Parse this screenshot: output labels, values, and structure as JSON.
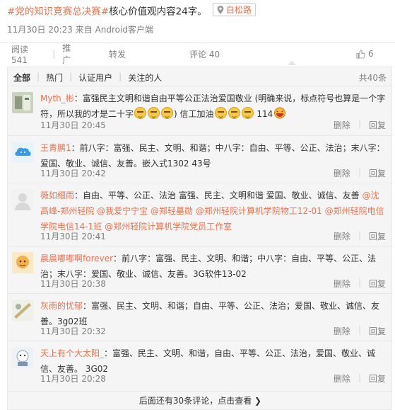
{
  "post": {
    "hashtag": "#党的知识竞赛总决赛#",
    "text": "核心价值观内容24字。",
    "location": "白松路",
    "meta": "11月30日 20:23 来自 Android客户端"
  },
  "actions": {
    "reads": "阅读 541",
    "promote": "推广",
    "repost": "转发",
    "comment": "评论 40",
    "likes": "6"
  },
  "filters": [
    "全部",
    "热门",
    "认证用户",
    "关注的人"
  ],
  "total": "共40条",
  "ops": {
    "delete": "删除",
    "reply": "回复"
  },
  "comments": [
    {
      "user": "Myth_彬",
      "colon": "：",
      "text_a": "富强民主文明和谐自由平等公正法治爱国敬业 (明确来说，标点符号也算是一个字符，所以我的才是二十字",
      "text_b": ") 信工加油",
      "text_c": " 114",
      "time": "11月30日 20:45"
    },
    {
      "user": "王青鹏1",
      "colon": "：",
      "text": "前八字：富强、民主、文明、和谐；中八字：自由、平等、公正、法治；末八字：爱国、敬业、诚信、友善。嵌入式1302 43号",
      "time": "11月30日 20:42"
    },
    {
      "user": "薇如细雨",
      "colon": "：",
      "text": "自由、平等、公正、法治 富强、民主、文明和谐 爱国、敬业、诚信、友善",
      "mentions": [
        "@沈高峰-郑州轻院",
        "@我爱宁宁宝",
        "@郑轻墓勋",
        "@郑州轻院计算机学院物工12-01",
        "@郑州轻院电信学院电信14-1班",
        "@郑州轻院计算机学院党员工作室"
      ],
      "time": "11月30日 20:41"
    },
    {
      "user": "晨晨嘟嘟啊forever",
      "colon": "：",
      "text": "前八字：富强、民主、文明、和谐；中八字：自由、平等、公正、法治；末八字：爱国、敬业、诚信、友善。3G软件13-02",
      "time": "11月30日 20:38"
    },
    {
      "user": "灰雨的忧郁",
      "colon": "：",
      "text": "富强、民主、文明、和谐；自由、平等、公正、法治；爱国、敬业、诚信、友善。3g02班",
      "time": "11月30日 20:32"
    },
    {
      "user": "天上有个大太阳_",
      "colon": "：",
      "text": "富强、民主、文明、和谐，自由、平等、公正、法治，爱国、敬业、诚信、友善。 3G02",
      "time": "11月30日 20:28"
    }
  ],
  "more": "后面还有30条评论，点击查看 ❯",
  "colors": {
    "accent": "#eb7350",
    "muted": "#808080",
    "panel": "#f5f5f5"
  },
  "icons": [
    "location-pin-icon",
    "thumb-up-icon",
    "smile-emoji-icon",
    "laugh-emoji-icon"
  ]
}
